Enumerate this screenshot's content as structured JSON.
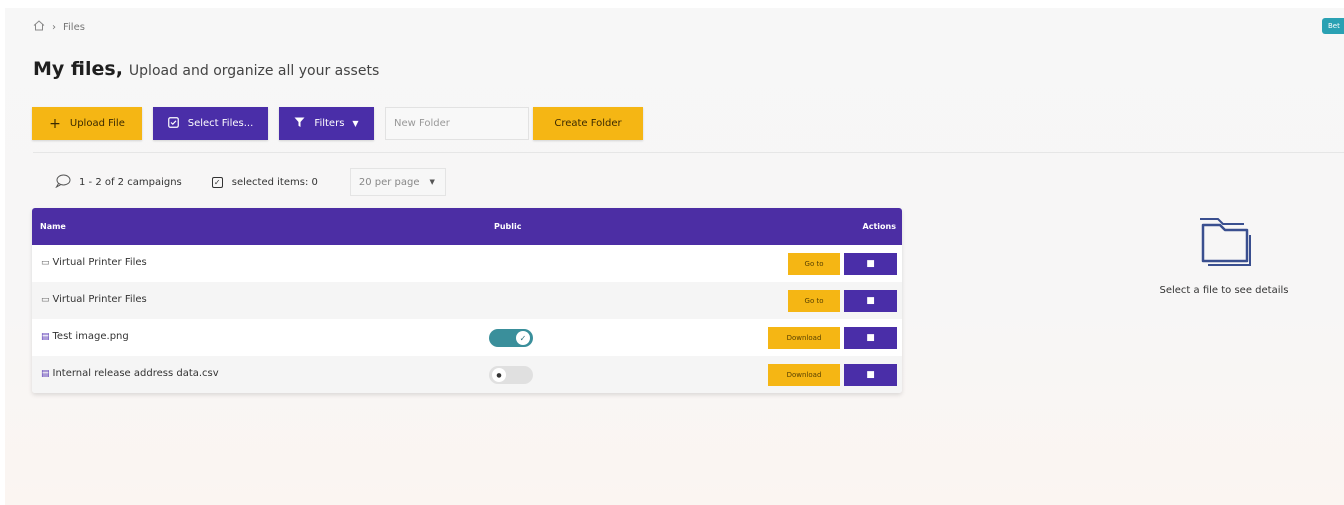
{
  "breadcrumb": {
    "home_icon": "home-icon",
    "current": "Files"
  },
  "beta_label": "Bet",
  "header": {
    "title": "My files,",
    "subtitle": "Upload and organize all your assets"
  },
  "toolbar": {
    "upload_label": "Upload File",
    "select_label": "Select Files...",
    "filters_label": "Filters",
    "folder_placeholder": "New Folder",
    "create_label": "Create Folder"
  },
  "meta": {
    "count_text": "1 - 2 of 2 campaigns",
    "selected_text": "selected items: 0",
    "per_page": "20 per page"
  },
  "table": {
    "columns": {
      "name": "Name",
      "public": "Public",
      "actions": "Actions"
    },
    "rows": [
      {
        "name": "Virtual Printer Files",
        "type": "folder",
        "action": "Go to"
      },
      {
        "name": "Virtual Printer Files",
        "type": "folder",
        "action": "Go to"
      },
      {
        "name": "Test image.png",
        "type": "file",
        "public": true,
        "action": "Download"
      },
      {
        "name": "Internal release address data.csv",
        "type": "file",
        "public": false,
        "action": "Download"
      }
    ]
  },
  "details": {
    "empty_text": "Select a file to see details"
  },
  "colors": {
    "primary": "#4a2ea8",
    "accent": "#f5b614",
    "toggle_on": "#3a8f9b",
    "beta": "#2aa1b3"
  }
}
